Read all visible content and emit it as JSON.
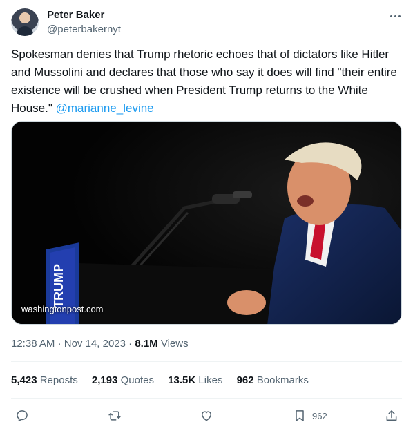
{
  "author": {
    "display_name": "Peter Baker",
    "handle": "@peterbakernyt"
  },
  "tweet": {
    "text": "Spokesman denies that Trump rhetoric echoes that of dictators like Hitler and Mussolini and declares that those who say it does will find \"their entire existence will be crushed when President Trump returns to the White House.\" ",
    "mention": "@marianne_levine",
    "media_caption": "washingtonpost.com",
    "time": "12:38 AM",
    "separator": "·",
    "date": "Nov 14, 2023",
    "views_count": "8.1M",
    "views_label": "Views"
  },
  "stats": {
    "reposts_count": "5,423",
    "reposts_label": "Reposts",
    "quotes_count": "2,193",
    "quotes_label": "Quotes",
    "likes_count": "13.5K",
    "likes_label": "Likes",
    "bookmarks_count": "962",
    "bookmarks_label": "Bookmarks"
  },
  "actions": {
    "bookmark_count": "962"
  },
  "colors": {
    "accent": "#1d9bf0",
    "secondary_text": "#536471",
    "primary_text": "#0f1419",
    "divider": "#eff3f4"
  },
  "icons": [
    "more-icon",
    "reply-icon",
    "retweet-icon",
    "like-icon",
    "bookmark-icon",
    "share-icon"
  ]
}
